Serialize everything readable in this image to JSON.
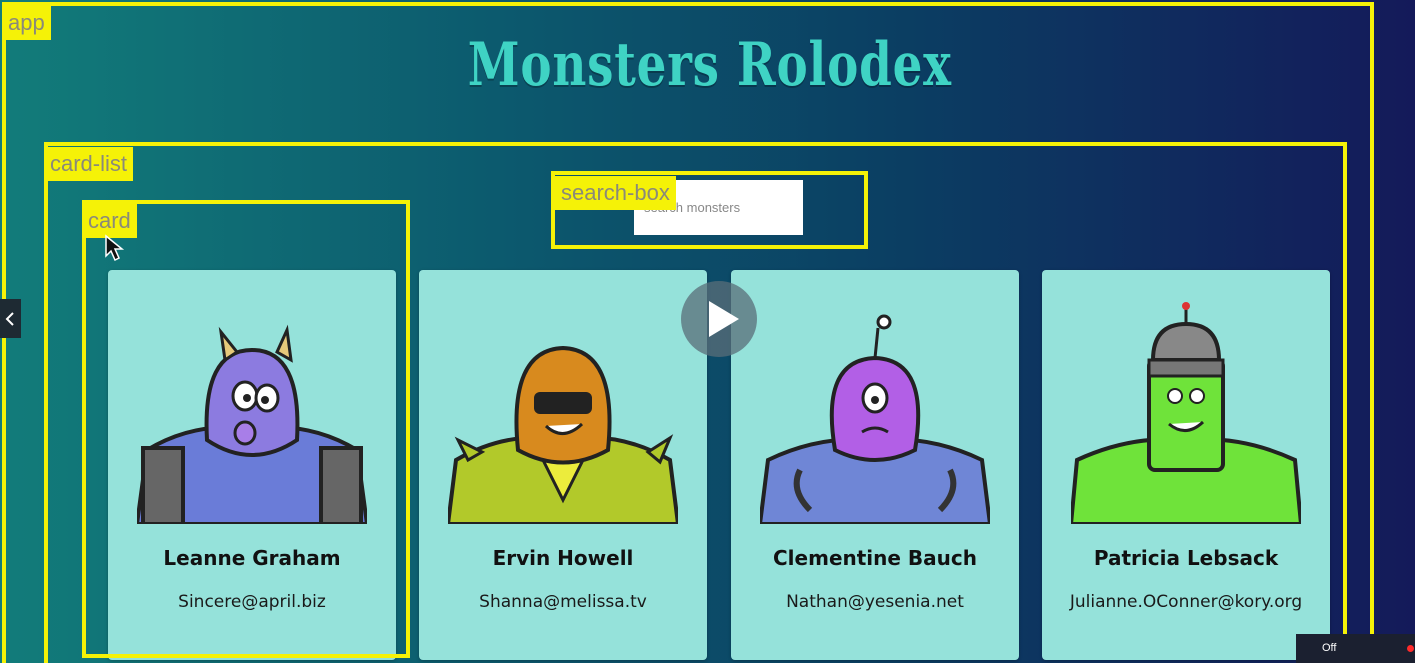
{
  "app": {
    "title": "Monsters Rolodex"
  },
  "overlay_labels": {
    "app": "app",
    "card_list": "card-list",
    "search_box": "search-box",
    "card": "card"
  },
  "search": {
    "placeholder": "search monsters",
    "value": ""
  },
  "monsters": [
    {
      "name": "Leanne Graham",
      "email": "Sincere@april.biz",
      "color": "#8c7be0"
    },
    {
      "name": "Ervin Howell",
      "email": "Shanna@melissa.tv",
      "color": "#d88a1e"
    },
    {
      "name": "Clementine Bauch",
      "email": "Nathan@yesenia.net",
      "color": "#b25fe6"
    },
    {
      "name": "Patricia Lebsack",
      "email": "Julianne.OConner@kory.org",
      "color": "#6fe33a"
    }
  ],
  "player": {
    "caption_toggle": "Off",
    "play_icon": "play-icon",
    "prev_icon": "chevron-left-icon"
  },
  "colors": {
    "highlight": "#f5f207",
    "card_bg": "#95e2da",
    "title": "#3fd3c4"
  }
}
